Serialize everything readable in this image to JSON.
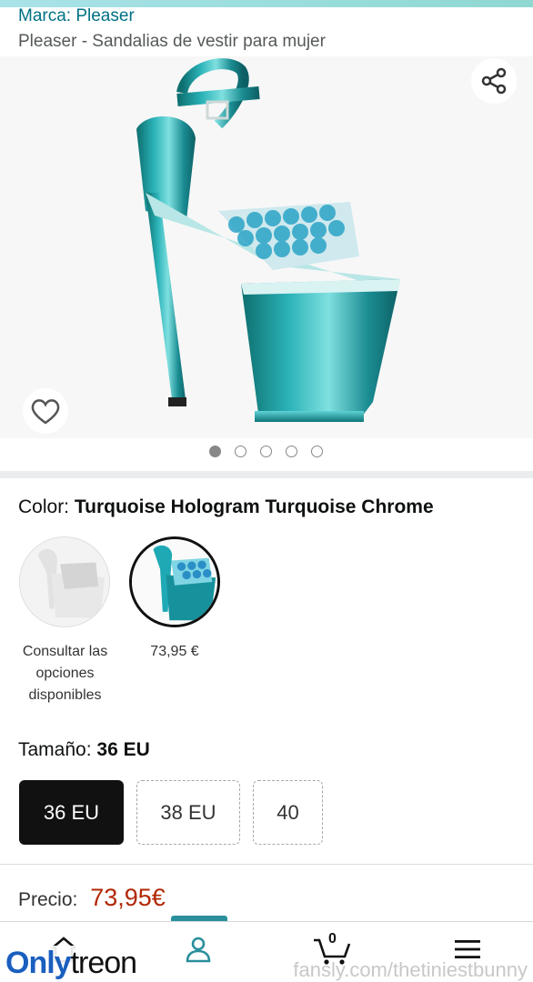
{
  "header": {
    "brand": "Marca: Pleaser",
    "title": "Pleaser - Sandalias de vestir para mujer"
  },
  "gallery": {
    "image_count": 5,
    "active_index": 0,
    "share_icon": "share-icon",
    "favorite_icon": "heart-icon"
  },
  "color": {
    "label": "Color:",
    "selected": "Turquoise Hologram Turquoise Chrome",
    "swatches": [
      {
        "label": "Consultar las opciones disponibles",
        "selected": false
      },
      {
        "label": "73,95 €",
        "selected": true
      }
    ]
  },
  "size": {
    "label": "Tamaño:",
    "selected": "36 EU",
    "options": [
      "36 EU",
      "38 EU",
      "40"
    ]
  },
  "price": {
    "label": "Precio:",
    "amount": "73,95€"
  },
  "navbar": {
    "active": "account",
    "cart_count": "0"
  },
  "watermark": {
    "left_a": "Only",
    "left_b": "treon",
    "right": "fansly.com/thetiniestbunny"
  },
  "colors": {
    "link": "#007185",
    "price": "#b12704",
    "accent": "#2a8f9c",
    "turquoise": "#1fa9b5"
  }
}
